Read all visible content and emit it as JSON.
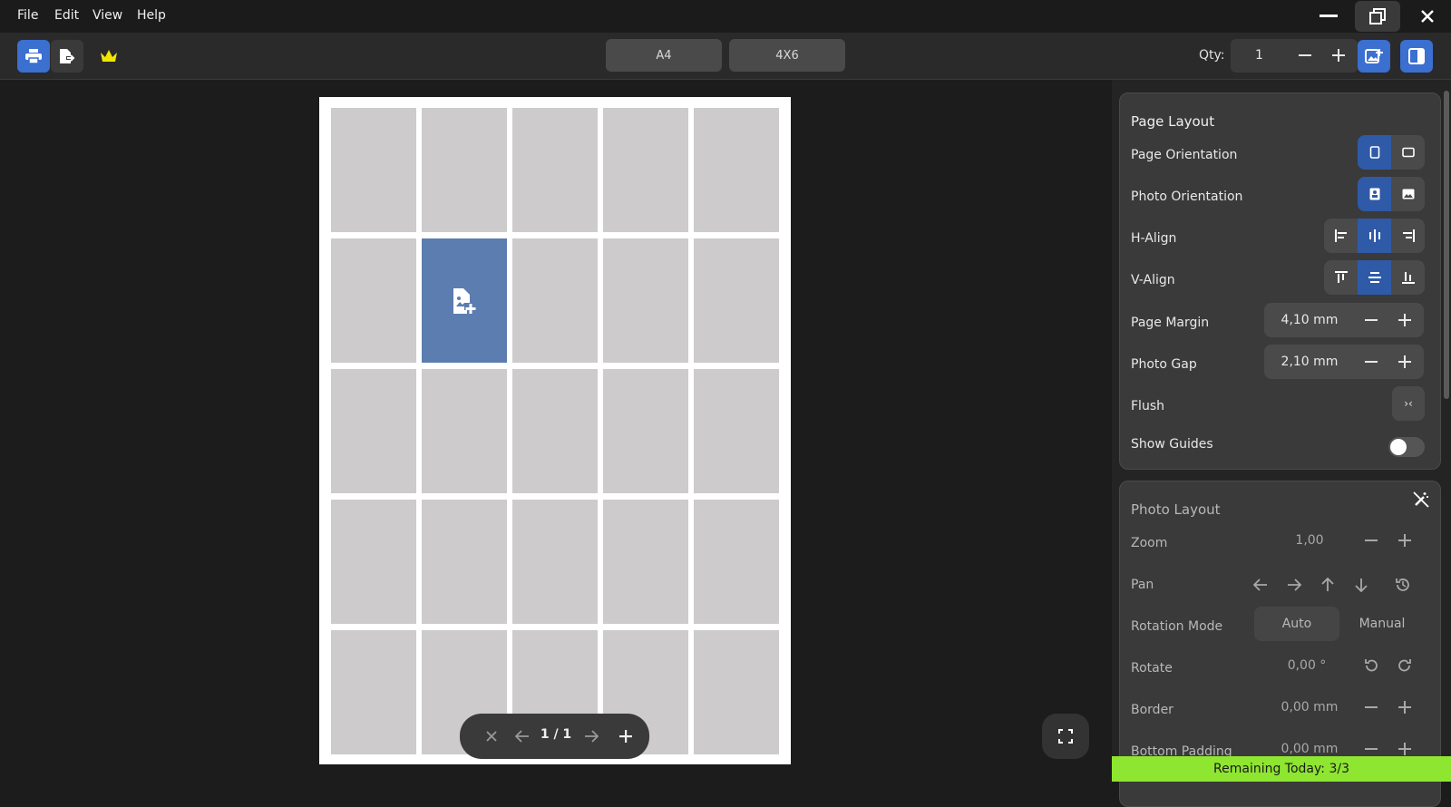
{
  "menu": {
    "items": [
      "File",
      "Edit",
      "View",
      "Help"
    ]
  },
  "window_controls": {
    "minimize_icon": "minimize-icon",
    "restore_icon": "restore-icon",
    "close_icon": "close-icon"
  },
  "toolbar": {
    "print_icon": "printer-icon",
    "export_icon": "export-icon",
    "premium_icon": "crown-icon",
    "paper_sizes": [
      "A4",
      "4X6"
    ],
    "qty_label": "Qty:",
    "qty_value": "1",
    "accent_color": "#3b6fd0",
    "premium_color": "#f2e600"
  },
  "canvas": {
    "grid": {
      "columns": 5,
      "rows": 5,
      "selected_row": 2,
      "selected_column": 2
    },
    "cell_color": "#cdcbcc",
    "selected_color": "#5b7db0",
    "selected_cell_icon": "add-image-icon"
  },
  "pager": {
    "page_text": "1 / 1"
  },
  "page_layout": {
    "title": "Page Layout",
    "page_orientation_label": "Page Orientation",
    "photo_orientation_label": "Photo Orientation",
    "h_align_label": "H-Align",
    "v_align_label": "V-Align",
    "page_margin_label": "Page Margin",
    "page_margin_value": "4,10 mm",
    "photo_gap_label": "Photo Gap",
    "photo_gap_value": "2,10 mm",
    "flush_label": "Flush",
    "flush_glyph": "›‹",
    "show_guides_label": "Show Guides",
    "show_guides_on": false
  },
  "photo_layout": {
    "title": "Photo Layout",
    "zoom_label": "Zoom",
    "zoom_value": "1,00",
    "pan_label": "Pan",
    "rotation_mode_label": "Rotation Mode",
    "rotation_modes": [
      "Auto",
      "Manual"
    ],
    "rotate_label": "Rotate",
    "rotate_value": "0,00 °",
    "border_label": "Border",
    "border_value": "0,00 mm",
    "bottom_padding_label": "Bottom Padding",
    "bottom_padding_value": "0,00 mm"
  },
  "status": {
    "remaining_text": "Remaining Today: 3/3",
    "color": "#8ee630"
  }
}
